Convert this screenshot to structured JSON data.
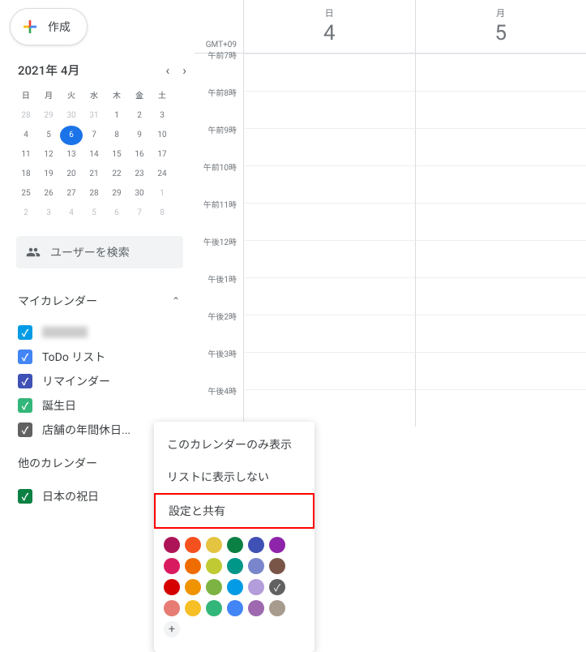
{
  "create": {
    "label": "作成"
  },
  "month": {
    "title": "2021年 4月"
  },
  "timezone": "GMT+09",
  "weekdays": [
    "日",
    "月",
    "火",
    "水",
    "木",
    "金",
    "土"
  ],
  "weeks": [
    [
      "28",
      "29",
      "30",
      "31",
      "1",
      "2",
      "3"
    ],
    [
      "4",
      "5",
      "6",
      "7",
      "8",
      "9",
      "10"
    ],
    [
      "11",
      "12",
      "13",
      "14",
      "15",
      "16",
      "17"
    ],
    [
      "18",
      "19",
      "20",
      "21",
      "22",
      "23",
      "24"
    ],
    [
      "25",
      "26",
      "27",
      "28",
      "29",
      "30",
      "1"
    ],
    [
      "2",
      "3",
      "4",
      "5",
      "6",
      "7",
      "8"
    ]
  ],
  "search": {
    "label": "ユーザーを検索"
  },
  "my_calendars": {
    "title": "マイカレンダー",
    "items": [
      {
        "label": " ",
        "color": "#039be5"
      },
      {
        "label": "ToDo リスト",
        "color": "#4285f4"
      },
      {
        "label": "リマインダー",
        "color": "#3f51b5"
      },
      {
        "label": "誕生日",
        "color": "#33b679"
      },
      {
        "label": "店舗の年間休日...",
        "color": "#616161"
      }
    ]
  },
  "other_calendars": {
    "title": "他のカレンダー",
    "items": [
      {
        "label": "日本の祝日",
        "color": "#0b8043"
      }
    ]
  },
  "days": [
    {
      "label": "日",
      "num": "4"
    },
    {
      "label": "月",
      "num": "5"
    }
  ],
  "times": [
    "午前7時",
    "午前8時",
    "午前9時",
    "午前10時",
    "午前11時",
    "午後12時",
    "午後1時",
    "午後2時",
    "午後3時",
    "午後4時"
  ],
  "menu": {
    "only_show": "このカレンダーのみ表示",
    "hide": "リストに表示しない",
    "settings": "設定と共有"
  },
  "colors": [
    "#ad1457",
    "#f4511e",
    "#e4c441",
    "#0b8043",
    "#3f51b5",
    "#8e24aa",
    "#d81b60",
    "#ef6c00",
    "#c0ca33",
    "#009688",
    "#7986cb",
    "#795548",
    "#d50000",
    "#f09300",
    "#7cb342",
    "#039be5",
    "#b39ddb",
    "#616161",
    "#e67c73",
    "#f6bf26",
    "#33b679",
    "#4285f4",
    "#9e69af",
    "#a79b8e"
  ],
  "selected_color_index": 17
}
